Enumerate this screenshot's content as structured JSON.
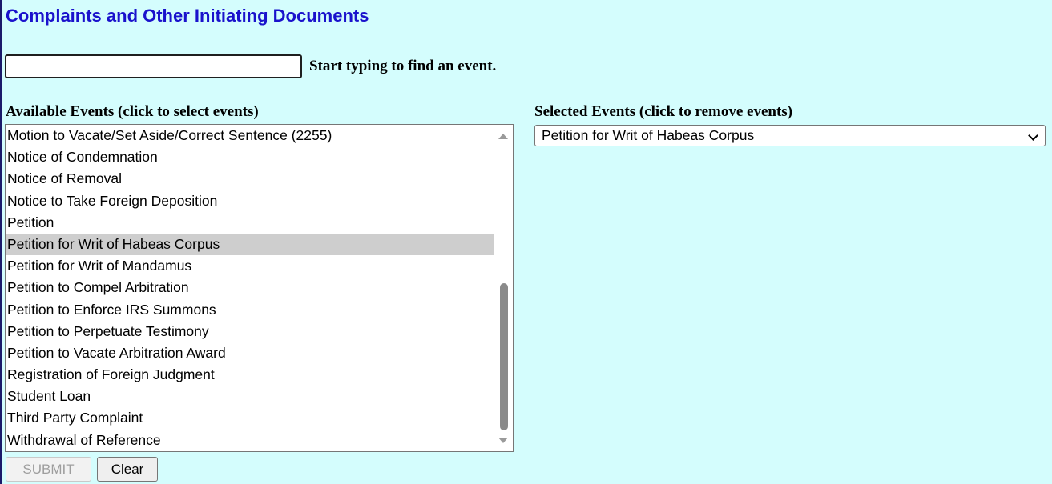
{
  "page": {
    "title": "Complaints and Other Initiating Documents"
  },
  "search": {
    "value": "",
    "hint": "Start typing to find an event."
  },
  "available": {
    "heading": "Available Events (click to select events)",
    "items": [
      "Motion to Vacate/Set Aside/Correct Sentence (2255)",
      "Notice of Condemnation",
      "Notice of Removal",
      "Notice to Take Foreign Deposition",
      "Petition",
      "Petition for Writ of Habeas Corpus",
      "Petition for Writ of Mandamus",
      "Petition to Compel Arbitration",
      "Petition to Enforce IRS Summons",
      "Petition to Perpetuate Testimony",
      "Petition to Vacate Arbitration Award",
      "Registration of Foreign Judgment",
      "Student Loan",
      "Third Party Complaint",
      "Withdrawal of Reference"
    ],
    "highlighted": "Petition for Writ of Habeas Corpus"
  },
  "selected": {
    "heading": "Selected Events (click to remove events)",
    "value": "Petition for Writ of Habeas Corpus"
  },
  "buttons": {
    "submit_label": "SUBMIT",
    "clear_label": "Clear"
  },
  "colors": {
    "background": "#d4fdfd",
    "title": "#1a12cc",
    "highlight": "#cecece"
  }
}
